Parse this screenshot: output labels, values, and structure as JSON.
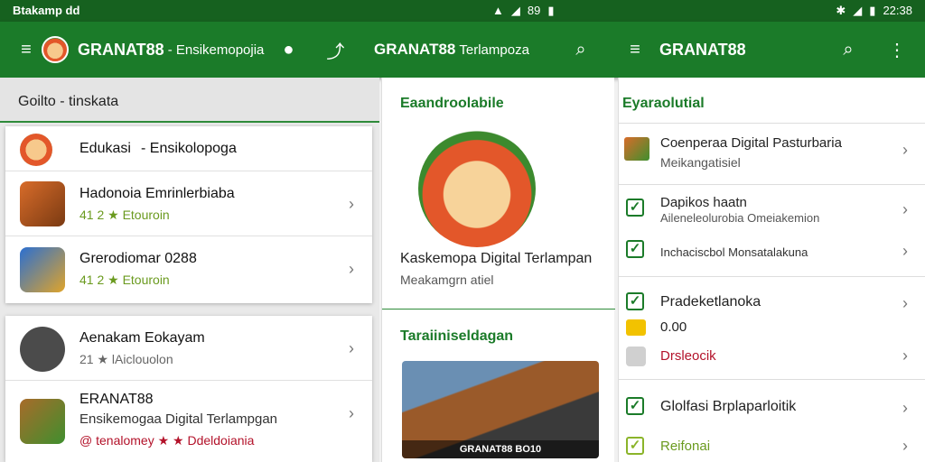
{
  "status": {
    "left_text": "Btakamp dd",
    "mid_text": "89",
    "right_text": "22:38"
  },
  "appbar": {
    "left": {
      "title": "GRANAT88",
      "subtitle": "- Ensikemopojia"
    },
    "mid": {
      "title": "GRANAT88",
      "subtitle": "Terlampoza"
    },
    "right": {
      "title": "GRANAT88"
    }
  },
  "panel1": {
    "header": "Goilto - tinskata",
    "card1": [
      {
        "title": "Edukasi",
        "title_rest": "- Ensikolopoga",
        "subtitle": ""
      },
      {
        "title": "Hadonoia Emrinlerbiaba",
        "subtitle": "41 2 ★ Etouroin"
      },
      {
        "title": "Grerodiomar 0288",
        "subtitle": "41 2 ★ Etouroin"
      }
    ],
    "card2": [
      {
        "title": "Aenakam Eokayam",
        "subtitle": "21 ★ lAiclouolon"
      },
      {
        "title": "ERANAT88",
        "subtitle": "Ensikemogaa Digital Terlampgan",
        "extra": "@ tenalomey ★ ★ Ddeldoiania"
      }
    ]
  },
  "panel2": {
    "section1": "Eaandroolabile",
    "item_title": "Kaskemopa Digital Terlampan",
    "item_sub": "Meakamgrn atiel",
    "section2": "Taraiiniseldagan",
    "image_caption": "GRANAT88 BO10"
  },
  "panel3": {
    "section": "Eyaraolutial",
    "rows": [
      {
        "title": "Coenperaa Digital Pasturbaria",
        "subtitle": "Meikangatisiel"
      },
      {
        "title": "Dapikos haatn",
        "subtitle": "Aileneleolurobia Omeiakemion"
      },
      {
        "title": "",
        "subtitle": "Inchaciscbol Monsatalakuna"
      },
      {
        "title": "Pradeketlanoka",
        "subtitle": ""
      },
      {
        "title": "0.00",
        "subtitle": ""
      },
      {
        "title": "Drsleocik",
        "subtitle": ""
      },
      {
        "title": "Glolfasi Brplaparloitik",
        "subtitle": ""
      },
      {
        "title": "Reifonai",
        "subtitle": ""
      }
    ]
  },
  "colors": {
    "appbar": "#1b7b29",
    "status": "#16611f",
    "accent": "#1b7b29",
    "link_red": "#b3122a"
  }
}
